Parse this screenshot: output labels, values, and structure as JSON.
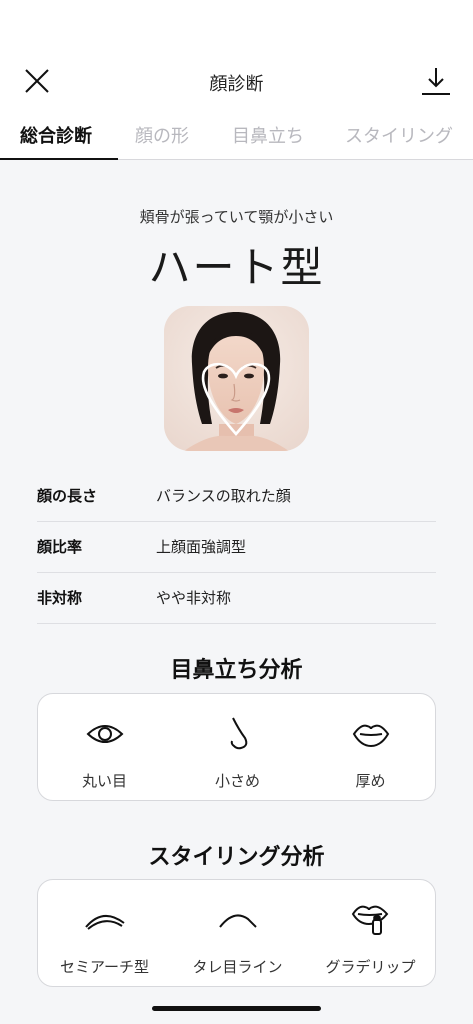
{
  "header": {
    "title": "顔診断",
    "close_icon": "close-icon",
    "download_icon": "download-icon"
  },
  "tabs": [
    {
      "label": "総合診断",
      "active": true
    },
    {
      "label": "顔の形",
      "active": false
    },
    {
      "label": "目鼻立ち",
      "active": false
    },
    {
      "label": "スタイリング",
      "active": false
    }
  ],
  "result": {
    "subtitle": "頬骨が張っていて顎が小さい",
    "type": "ハート型"
  },
  "info": [
    {
      "label": "顔の長さ",
      "value": "バランスの取れた顔"
    },
    {
      "label": "顔比率",
      "value": "上顔面強調型"
    },
    {
      "label": "非対称",
      "value": "やや非対称"
    }
  ],
  "features": {
    "title": "目鼻立ち分析",
    "items": [
      {
        "icon": "eye-icon",
        "label": "丸い目"
      },
      {
        "icon": "nose-icon",
        "label": "小さめ"
      },
      {
        "icon": "lips-icon",
        "label": "厚め"
      }
    ]
  },
  "styling": {
    "title": "スタイリング分析",
    "items": [
      {
        "icon": "arched-brow-icon",
        "label": "セミアーチ型"
      },
      {
        "icon": "droopy-eyeliner-icon",
        "label": "タレ目ライン"
      },
      {
        "icon": "gradient-lip-icon",
        "label": "グラデリップ"
      }
    ]
  },
  "colors": {
    "accent": "#111111",
    "tab_inactive": "#b8b8be",
    "background": "#f5f6f8",
    "card_border": "#d7d8dc"
  }
}
